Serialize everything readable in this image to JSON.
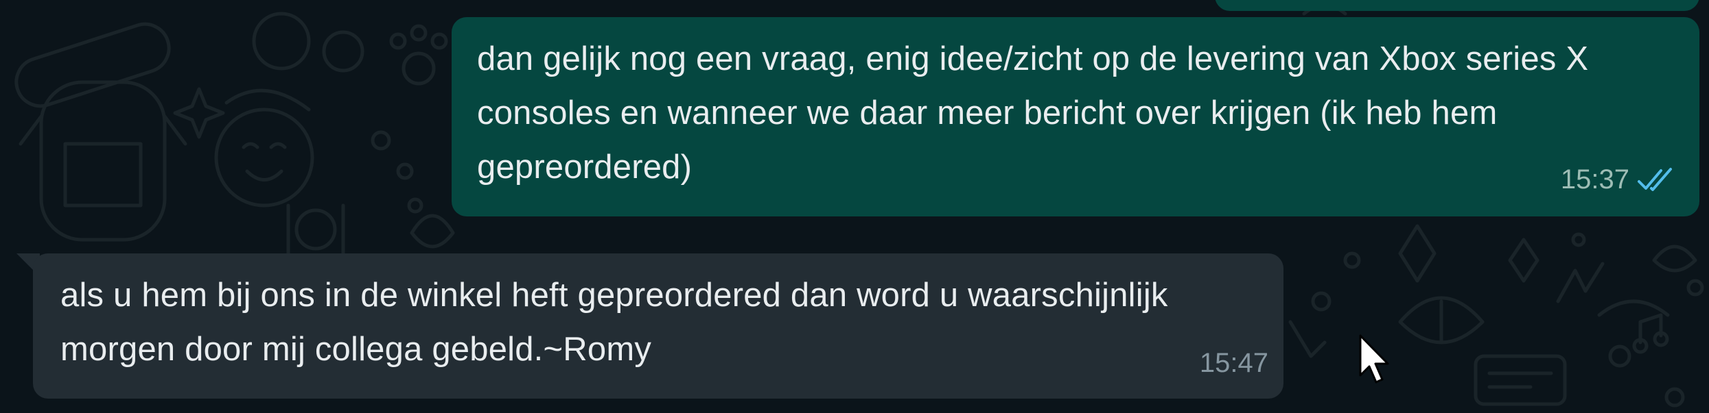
{
  "messages": {
    "outgoing": {
      "text": "dan gelijk nog een vraag, enig idee/zicht op de levering van Xbox series X consoles en wanneer we daar meer bericht over krijgen (ik heb hem gepreordered)",
      "time": "15:37",
      "status_icon": "double-check-read-icon",
      "bubble_color": "#054740",
      "tick_color": "#53bdeb"
    },
    "incoming": {
      "text": "als u hem bij ons in de winkel heft gepreordered dan word u waarschijnlijk morgen door mij collega gebeld.~Romy",
      "time": "15:47",
      "bubble_color": "#232d34"
    }
  },
  "theme": {
    "background": "#0b141a",
    "text_color": "#e9edef"
  }
}
